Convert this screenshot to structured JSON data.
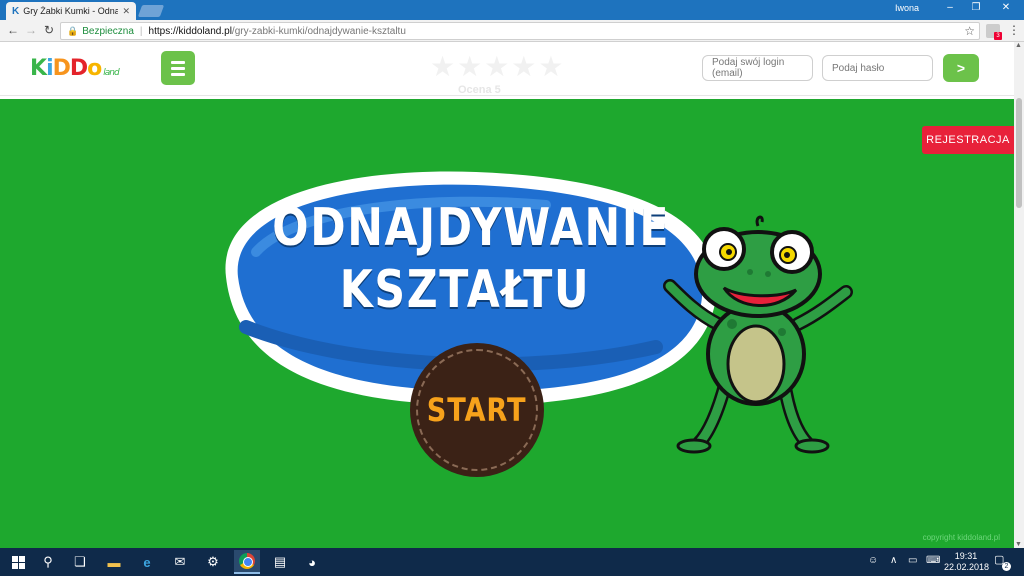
{
  "browser": {
    "tab_title": "Gry Żabki Kumki - Odnaj",
    "tab_logo": "K",
    "tab_close": "✕",
    "user": "Iwona",
    "window_controls": {
      "minimize": "–",
      "maximize": "❐",
      "close": "✕"
    },
    "nav": {
      "back": "←",
      "forward": "→",
      "reload": "↻"
    },
    "address": {
      "lock_icon": "🔒",
      "secure_label": "Bezpieczna",
      "separator": "|",
      "url_scheme_host": "https://kiddoland.pl",
      "url_path": "/gry-zabki-kumki/odnajdywanie-ksztaltu"
    },
    "bookmark_star": "☆",
    "extension_badge": "3",
    "menu": "⋮"
  },
  "site": {
    "logo": {
      "k": "K",
      "i": "i",
      "d1": "D",
      "d2": "D",
      "o": "o",
      "land": "land"
    },
    "menu_icon": "hamburger-menu",
    "rating": {
      "stars": "★★★★★",
      "label": "Ocena 5"
    },
    "login_placeholder": "Podaj swój login (email)",
    "password_placeholder": "Podaj hasło",
    "login_submit": ">"
  },
  "game": {
    "register_label": "REJESTRACJA",
    "title_line1": "ODNAJDYWANIE",
    "title_line2": "KSZTAŁTU",
    "start_label": "START",
    "copyright": "copyright kiddoland.pl",
    "colors": {
      "background": "#1ea82e",
      "blob": "#1f6fd1",
      "start": "#3b2216",
      "start_text": "#f7a21b"
    }
  },
  "taskbar": {
    "time": "19:31",
    "date": "22.02.2018",
    "notifications": "2"
  }
}
